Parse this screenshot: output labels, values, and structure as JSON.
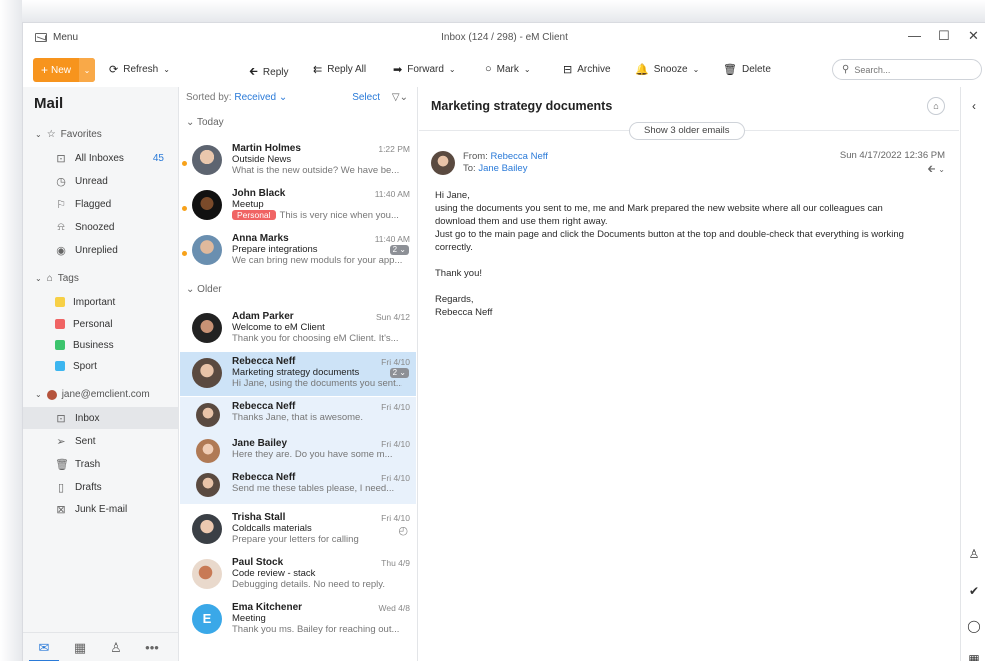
{
  "window": {
    "menu_label": "Menu",
    "title": "Inbox (124 / 298) - eM Client",
    "minimize": "—",
    "maximize": "☐",
    "close": "✕"
  },
  "toolbar": {
    "new_label": "New",
    "refresh_label": "Refresh",
    "reply_label": "Reply",
    "reply_all_label": "Reply All",
    "forward_label": "Forward",
    "mark_label": "Mark",
    "archive_label": "Archive",
    "snooze_label": "Snooze",
    "delete_label": "Delete",
    "search_placeholder": "Search..."
  },
  "sidebar": {
    "title": "Mail",
    "favorites_label": "Favorites",
    "favorites": [
      {
        "label": "All Inboxes",
        "count": "45",
        "icon": "inbox-icon"
      },
      {
        "label": "Unread",
        "icon": "clock-icon"
      },
      {
        "label": "Flagged",
        "icon": "flag-icon"
      },
      {
        "label": "Snoozed",
        "icon": "bell-icon"
      },
      {
        "label": "Unreplied",
        "icon": "eye-icon"
      }
    ],
    "tags_label": "Tags",
    "tags": [
      {
        "label": "Important",
        "color": "#f7d046"
      },
      {
        "label": "Personal",
        "color": "#f06464"
      },
      {
        "label": "Business",
        "color": "#3cc46d"
      },
      {
        "label": "Sport",
        "color": "#3cb6f0"
      }
    ],
    "account_label": "jane@emclient.com",
    "folders": [
      {
        "label": "Inbox",
        "icon": "inbox-icon"
      },
      {
        "label": "Sent",
        "icon": "send-icon"
      },
      {
        "label": "Trash",
        "icon": "trash-icon"
      },
      {
        "label": "Drafts",
        "icon": "draft-icon"
      },
      {
        "label": "Junk E-mail",
        "icon": "junk-icon"
      }
    ]
  },
  "list": {
    "sorted_prefix": "Sorted by:",
    "sorted_value": "Received",
    "select_label": "Select",
    "group_today": "Today",
    "group_older": "Older",
    "messages": [
      {
        "from": "Martin Holmes",
        "subject": "Outside News",
        "preview": "What is the new outside? We have be...",
        "date": "1:22 PM"
      },
      {
        "from": "John Black",
        "subject": "Meetup",
        "tag": "Personal",
        "preview": "This is very nice when you...",
        "date": "11:40 AM"
      },
      {
        "from": "Anna Marks",
        "subject": "Prepare integrations",
        "preview": "We can bring new moduls for your app...",
        "date": "11:40 AM",
        "badge": "2"
      },
      {
        "from": "Adam Parker",
        "subject": "Welcome to eM Client",
        "preview": "Thank you for choosing eM Client. It's...",
        "date": "Sun 4/12"
      },
      {
        "from": "Rebecca Neff",
        "subject": "Marketing strategy documents",
        "preview": "Hi Jane, using the documents you sent...",
        "date": "Fri 4/10",
        "badge": "2"
      },
      {
        "from": "Rebecca Neff",
        "preview": "Thanks Jane, that is awesome.",
        "date": "Fri 4/10"
      },
      {
        "from": "Jane Bailey",
        "preview": "Here they are. Do you have some m...",
        "date": "Fri 4/10"
      },
      {
        "from": "Rebecca Neff",
        "preview": "Send me these tables please, I need...",
        "date": "Fri 4/10"
      },
      {
        "from": "Trisha Stall",
        "subject": "Coldcalls materials",
        "preview": "Prepare your letters for calling",
        "date": "Fri 4/10"
      },
      {
        "from": "Paul Stock",
        "subject": "Code review - stack",
        "preview": "Debugging details. No need to reply.",
        "date": "Thu 4/9"
      },
      {
        "from": "Ema Kitchener",
        "subject": "Meeting",
        "preview": "Thank you ms. Bailey for reaching out...",
        "date": "Wed 4/8",
        "initial": "E"
      }
    ]
  },
  "reader": {
    "subject": "Marketing strategy documents",
    "show_older": "Show 3 older emails",
    "from_label": "From:",
    "from_name": "Rebecca Neff",
    "to_label": "To:",
    "to_name": "Jane Bailey",
    "date": "Sun 4/17/2022 12:36 PM",
    "body": [
      "Hi Jane,",
      "using the documents you sent to me, me and Mark prepared the new website where all our colleagues can",
      "download them and use them right away.",
      "Just go to the main page and click the Documents button at the top and double-check that everything is working",
      "correctly.",
      "",
      "Thank you!",
      "",
      "Regards,",
      "Rebecca Neff"
    ]
  },
  "colors": {
    "accent": "#2a7ad8",
    "new_button": "#f7941d",
    "selected_row": "#cde3f7",
    "unread_dot": "#f7a21b"
  }
}
